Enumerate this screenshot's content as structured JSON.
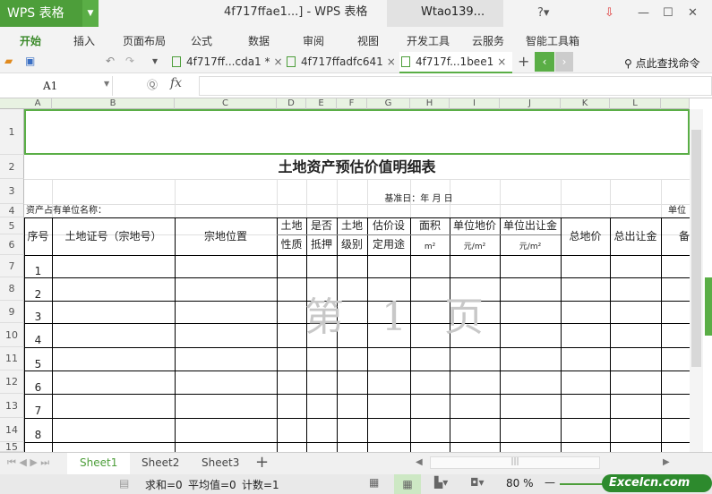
{
  "app": {
    "name": "WPS 表格",
    "doc_title": "4f717ffae1...] - WPS 表格",
    "user": "Wtao139..."
  },
  "menu": [
    "开始",
    "插入",
    "页面布局",
    "公式",
    "数据",
    "审阅",
    "视图",
    "开发工具",
    "云服务",
    "智能工具箱"
  ],
  "doc_tabs": [
    {
      "label": "4f717ff...cda1 *"
    },
    {
      "label": "4f717ffadfc641"
    },
    {
      "label": "4f717f...1bee1"
    }
  ],
  "search_label": "点此查找命令",
  "name_box": "A1",
  "fx": "fx",
  "columns": [
    "A",
    "B",
    "C",
    "D",
    "E",
    "F",
    "G",
    "H",
    "I",
    "J",
    "K",
    "L"
  ],
  "rows": [
    "1",
    "2",
    "3",
    "4",
    "5",
    "6",
    "7",
    "8",
    "9",
    "10",
    "11",
    "12",
    "13",
    "14",
    "15"
  ],
  "sheet": {
    "title": "土地资产预估价值明细表",
    "base_date": "基准日：年    月    日",
    "owner_label": "资产占有单位名称：",
    "unit_label": "单位",
    "headers": {
      "seq": "序号",
      "cert": "土地证号（宗地号）",
      "loc": "宗地位置",
      "nature1": "土地",
      "nature2": "性质",
      "mort1": "是否",
      "mort2": "抵押",
      "level1": "土地",
      "level2": "级别",
      "use1": "估价设",
      "use2": "定用途",
      "area": "面积",
      "area_unit": "m²",
      "unitprice": "单位地价",
      "unitprice_unit": "元/m²",
      "unitfee": "单位出让金",
      "unitfee_unit": "元/m²",
      "total": "总地价",
      "totalfee": "总出让金",
      "remark": "备"
    },
    "seq_values": [
      "1",
      "2",
      "3",
      "4",
      "5",
      "6",
      "7",
      "8"
    ],
    "watermark": "第 1 页"
  },
  "sheets": [
    "Sheet1",
    "Sheet2",
    "Sheet3"
  ],
  "status": {
    "sum": "求和=0",
    "avg": "平均值=0",
    "count": "计数=1",
    "zoom": "80 %"
  },
  "brand": "Excelcn.com"
}
